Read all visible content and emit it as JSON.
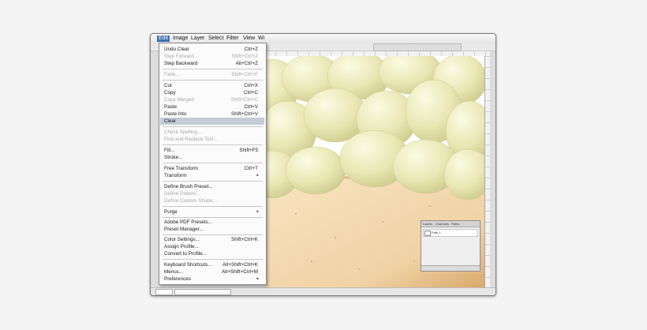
{
  "menubar": {
    "items": [
      {
        "label": "Edit"
      },
      {
        "label": "Image"
      },
      {
        "label": "Layer"
      },
      {
        "label": "Select"
      },
      {
        "label": "Filter"
      },
      {
        "label": "View"
      },
      {
        "label": "Wi"
      }
    ]
  },
  "edit_menu": {
    "items": [
      {
        "label": "Undo Clear",
        "shortcut": "Ctrl+Z",
        "enabled": true
      },
      {
        "label": "Step Forward",
        "shortcut": "Shift+Ctrl+Z",
        "enabled": false
      },
      {
        "label": "Step Backward",
        "shortcut": "Alt+Ctrl+Z",
        "enabled": true
      },
      {
        "label": "Fade...",
        "shortcut": "Shift+Ctrl+F",
        "enabled": false
      },
      {
        "label": "Cut",
        "shortcut": "Ctrl+X",
        "enabled": true
      },
      {
        "label": "Copy",
        "shortcut": "Ctrl+C",
        "enabled": true
      },
      {
        "label": "Copy Merged",
        "shortcut": "Shift+Ctrl+C",
        "enabled": false
      },
      {
        "label": "Paste",
        "shortcut": "Ctrl+V",
        "enabled": true
      },
      {
        "label": "Paste Into",
        "shortcut": "Shift+Ctrl+V",
        "enabled": true
      },
      {
        "label": "Clear",
        "shortcut": "",
        "enabled": true,
        "highlighted": true
      },
      {
        "label": "Check Spelling...",
        "shortcut": "",
        "enabled": false
      },
      {
        "label": "Find and Replace Text...",
        "shortcut": "",
        "enabled": false
      },
      {
        "label": "Fill...",
        "shortcut": "Shift+F5",
        "enabled": true
      },
      {
        "label": "Stroke...",
        "shortcut": "",
        "enabled": true
      },
      {
        "label": "Free Transform",
        "shortcut": "Ctrl+T",
        "enabled": true
      },
      {
        "label": "Transform",
        "shortcut": "",
        "enabled": true,
        "submenu": true
      },
      {
        "label": "Define Brush Preset...",
        "shortcut": "",
        "enabled": true
      },
      {
        "label": "Define Pattern...",
        "shortcut": "",
        "enabled": false
      },
      {
        "label": "Define Custom Shape...",
        "shortcut": "",
        "enabled": false
      },
      {
        "label": "Purge",
        "shortcut": "",
        "enabled": true,
        "submenu": true
      },
      {
        "label": "Adobe PDF Presets...",
        "shortcut": "",
        "enabled": true
      },
      {
        "label": "Preset Manager...",
        "shortcut": "",
        "enabled": true
      },
      {
        "label": "Color Settings...",
        "shortcut": "Shift+Ctrl+K",
        "enabled": true
      },
      {
        "label": "Assign Profile...",
        "shortcut": "",
        "enabled": true
      },
      {
        "label": "Convert to Profile...",
        "shortcut": "",
        "enabled": true
      },
      {
        "label": "Keyboard Shortcuts...",
        "shortcut": "Alt+Shift+Ctrl+K",
        "enabled": true
      },
      {
        "label": "Menus...",
        "shortcut": "Alt+Shift+Ctrl+M",
        "enabled": true
      },
      {
        "label": "Preferences",
        "shortcut": "",
        "enabled": true,
        "submenu": true
      }
    ],
    "submenu_arrow": "▸"
  },
  "layers_panel": {
    "tabs": [
      "Layers",
      "Channels",
      "Paths"
    ],
    "row_label": "Path 1"
  },
  "colors": {
    "menu_highlight": "#c4ccd8",
    "active_menu": "#3c6fb6",
    "grape": "#e9e7b3",
    "bowl": "#f0d2a4"
  }
}
